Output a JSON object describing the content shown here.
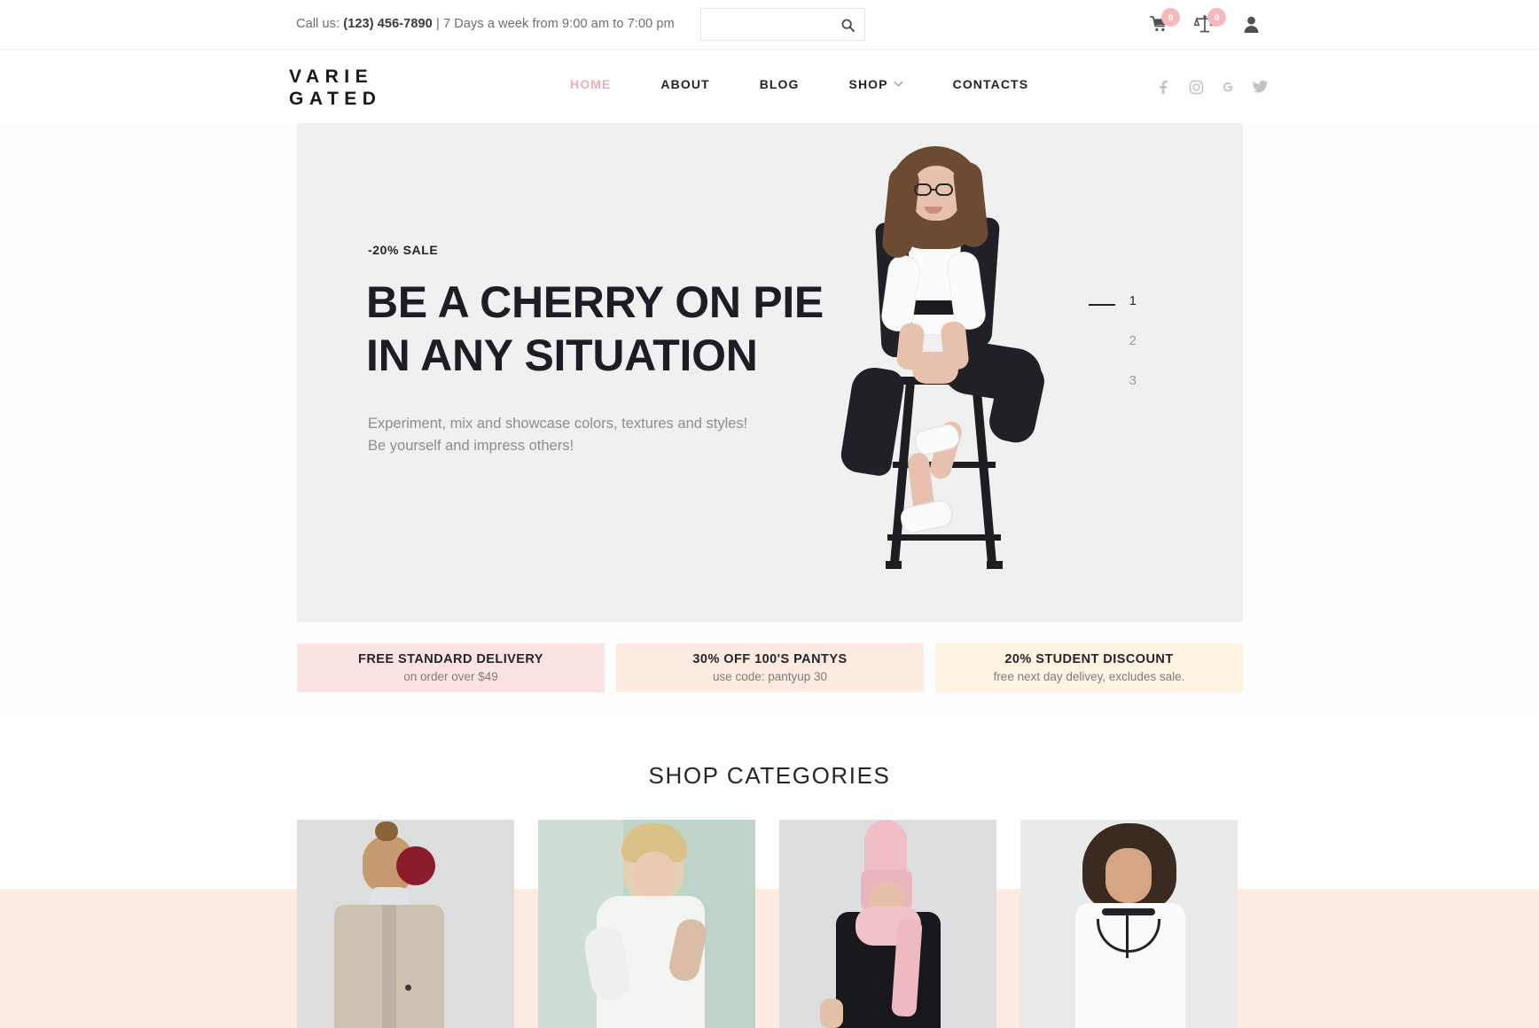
{
  "topbar": {
    "phone_prefix": "Call us: ",
    "phone": "(123) 456-7890",
    "hours": " | 7 Days a week from 9:00 am to 7:00 pm",
    "search_placeholder": "",
    "search_value": "",
    "search_icon": "search-icon",
    "cart": {
      "icon": "cart-icon",
      "count": "0"
    },
    "compare": {
      "icon": "compare-scales-icon",
      "count": "0"
    },
    "account": {
      "icon": "user-account-icon"
    }
  },
  "header": {
    "logo_line1": "VARIE",
    "logo_line2": "GATED",
    "nav": [
      {
        "label": "HOME",
        "active": true,
        "has_dropdown": false
      },
      {
        "label": "ABOUT",
        "active": false,
        "has_dropdown": false
      },
      {
        "label": "BLOG",
        "active": false,
        "has_dropdown": false
      },
      {
        "label": "SHOP",
        "active": false,
        "has_dropdown": true
      },
      {
        "label": "CONTACTS",
        "active": false,
        "has_dropdown": false
      }
    ],
    "socials": [
      {
        "name": "facebook-icon",
        "glyph": "f"
      },
      {
        "name": "instagram-icon",
        "glyph": ""
      },
      {
        "name": "google-icon",
        "glyph": "G"
      },
      {
        "name": "twitter-icon",
        "glyph": ""
      }
    ]
  },
  "hero": {
    "eyebrow": "-20% SALE",
    "title_line1": "BE A CHERRY ON PIE",
    "title_line2": "IN ANY SITUATION",
    "desc_line1": "Experiment, mix and showcase colors, textures and styles!",
    "desc_line2": "Be yourself and impress others!",
    "pagination": [
      {
        "label": "1",
        "active": true
      },
      {
        "label": "2",
        "active": false
      },
      {
        "label": "3",
        "active": false
      }
    ],
    "bg_color": "#f0f0f0"
  },
  "banners": [
    {
      "title": "FREE STANDARD DELIVERY",
      "subtitle": "on order over $49",
      "color": "#fce3e3"
    },
    {
      "title": "30% OFF 100'S PANTYS",
      "subtitle": "use code: pantyup 30",
      "color": "#fdeae0"
    },
    {
      "title": "20% STUDENT DISCOUNT",
      "subtitle": "free next day delivey, excludes sale.",
      "color": "#fdf3e1"
    }
  ],
  "categories": {
    "heading": "SHOP CATEGORIES",
    "band_color": "#fdeae3",
    "cards": [
      {
        "name": "category-card-coat"
      },
      {
        "name": "category-card-blouse"
      },
      {
        "name": "category-card-scarf"
      },
      {
        "name": "category-card-dress"
      }
    ]
  },
  "colors": {
    "accent_pink": "#f3adb4",
    "badge_pink": "#f9b8bc",
    "dark": "#23232b",
    "muted": "#8e8e8e"
  }
}
